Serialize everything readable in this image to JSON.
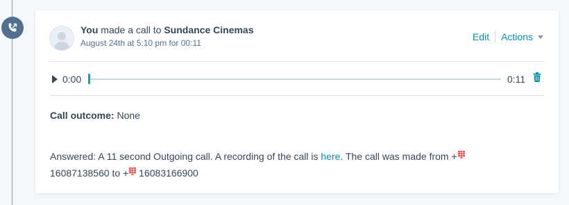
{
  "timeline": {
    "icon": "phone-outgoing-icon",
    "badge_color": "#516f90"
  },
  "activity": {
    "actor": "You",
    "action_text": " made a call to ",
    "contact": "Sundance Cinemas",
    "timestamp": "August 24th at 5:10 pm for 00:11",
    "edit_label": "Edit",
    "actions_label": "Actions"
  },
  "player": {
    "current_time": "0:00",
    "total_time": "0:11",
    "progress": 0,
    "play_icon": "play-icon",
    "delete_icon": "trash-icon"
  },
  "details": {
    "outcome_label": "Call outcome:",
    "outcome_value": " None",
    "answered_text_before_link": "Answered: A 11 second Outgoing call. A recording of the call is ",
    "link_text": "here",
    "answered_text_after_link": ". The call was made from +",
    "from_number": "16087138560",
    "to_text": " to +",
    "to_number": "16083166900",
    "flag_icon": "country-flag-icon"
  },
  "colors": {
    "link": "#0091ae",
    "text": "#33475b",
    "accent": "#00a4bd",
    "flag": "#f2545b"
  }
}
